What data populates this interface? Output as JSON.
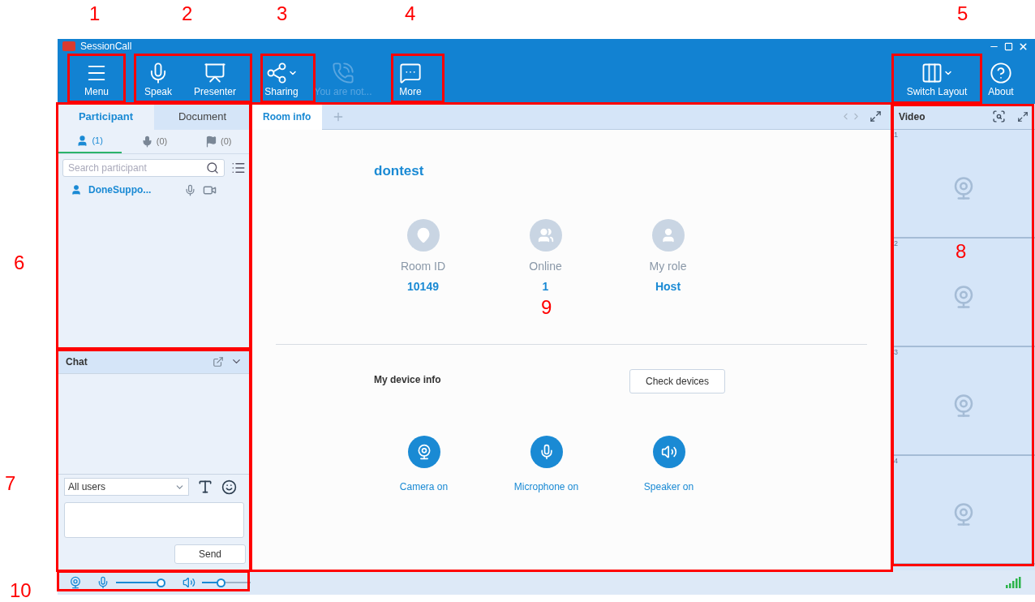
{
  "callouts": [
    {
      "label": "1"
    },
    {
      "label": "2"
    },
    {
      "label": "3"
    },
    {
      "label": "4"
    },
    {
      "label": "5"
    },
    {
      "label": "6"
    },
    {
      "label": "7"
    },
    {
      "label": "8"
    },
    {
      "label": "9"
    },
    {
      "label": "10"
    }
  ],
  "window": {
    "title": "SessionCall"
  },
  "toolbar": {
    "left": [
      {
        "label": "Menu",
        "kind": "menu",
        "disabled": false
      },
      {
        "label": "Speak",
        "kind": "mic",
        "disabled": false
      },
      {
        "label": "Presenter",
        "kind": "presenter",
        "disabled": false
      },
      {
        "label": "Sharing",
        "kind": "share",
        "disabled": false
      },
      {
        "label": "You are not...",
        "kind": "phone",
        "disabled": true
      },
      {
        "label": "More",
        "kind": "more",
        "disabled": false
      }
    ],
    "right": [
      {
        "label": "Switch Layout",
        "kind": "layout",
        "disabled": false
      },
      {
        "label": "About",
        "kind": "help",
        "disabled": false
      }
    ]
  },
  "participant_panel": {
    "tabs": [
      {
        "label": "Participant",
        "selected": true
      },
      {
        "label": "Document",
        "selected": false
      }
    ],
    "filters": [
      {
        "count": "(1)",
        "kind": "people",
        "selected": true
      },
      {
        "count": "(0)",
        "kind": "mic",
        "selected": false
      },
      {
        "count": "(0)",
        "kind": "flag",
        "selected": false
      }
    ],
    "search": {
      "placeholder": "Search participant"
    },
    "participants": [
      {
        "name": "DoneSuppo..."
      }
    ]
  },
  "chat": {
    "title": "Chat",
    "recipient": "All users",
    "send": "Send"
  },
  "room": {
    "tabs": [
      {
        "label": "Room info",
        "selected": true
      }
    ],
    "name": "dontest",
    "stats": [
      {
        "label": "Room ID",
        "value": "10149",
        "kind": "location"
      },
      {
        "label": "Online",
        "value": "1",
        "kind": "group"
      },
      {
        "label": "My role",
        "value": "Host",
        "kind": "person"
      }
    ],
    "device_title": "My device info",
    "check_button": "Check devices",
    "devices": [
      {
        "label": "Camera on",
        "kind": "camera",
        "on": true
      },
      {
        "label": "Microphone on",
        "kind": "mic",
        "on": true
      },
      {
        "label": "Speaker on",
        "kind": "speaker",
        "on": true
      }
    ]
  },
  "video": {
    "title": "Video",
    "slots": [
      "1",
      "2",
      "3",
      "4"
    ]
  },
  "status_bar": {
    "microphone": {
      "level": 0.92
    },
    "speaker": {
      "level": 0.38
    }
  }
}
